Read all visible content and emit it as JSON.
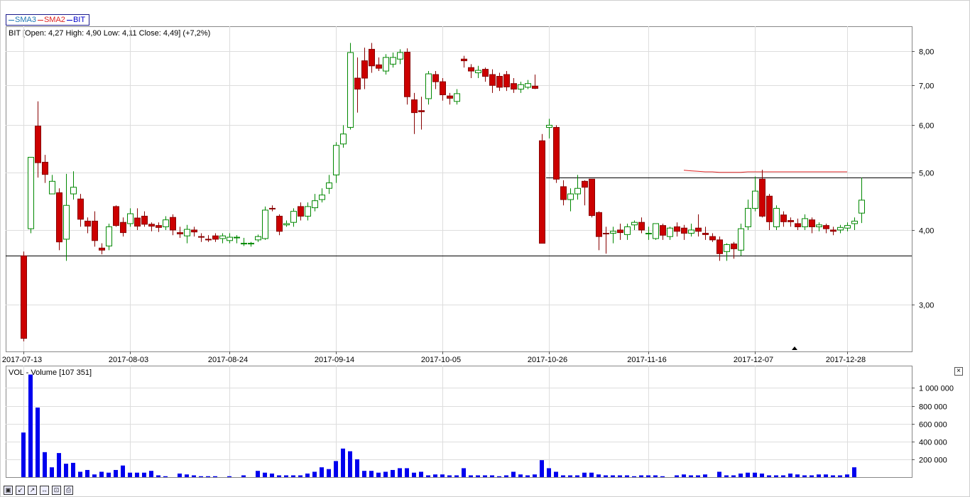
{
  "legend": [
    {
      "label": "SMA3",
      "color": "#1f77b4"
    },
    {
      "label": "SMA2",
      "color": "#dd2222"
    },
    {
      "label": "BIT",
      "color": "#0000cc"
    }
  ],
  "price_panel_title": "BIT [Open: 4,27  High: 4,90  Low: 4,11  Close: 4,49] (+7,2%)",
  "volume_panel_title": "VOL - Volume [107 351]",
  "toolbar": [
    {
      "name": "save-icon",
      "glyph": "▣"
    },
    {
      "name": "zoom-in-icon",
      "glyph": "↙"
    },
    {
      "name": "zoom-out-icon",
      "glyph": "↗"
    },
    {
      "name": "zoom-reset-icon",
      "glyph": "↔"
    },
    {
      "name": "fit-icon",
      "glyph": "⊡"
    },
    {
      "name": "print-icon",
      "glyph": "⎙"
    }
  ],
  "close_glyph": "×",
  "colors": {
    "up_body": "#ffffff",
    "up_outline": "#008800",
    "down_body": "#cc0000",
    "volume": "#0000ee",
    "grid": "#dddddd",
    "sma2": "#dd2222"
  },
  "chart_data": [
    {
      "type": "candlestick",
      "title": "BIT [Open: 4,27  High: 4,90  Low: 4,11  Close: 4,49] (+7,2%)",
      "scale": "log",
      "ylim": [
        2.5,
        8.8
      ],
      "y_ticks": [
        {
          "value": 3.0,
          "label": "3,00"
        },
        {
          "value": 4.0,
          "label": "4,00"
        },
        {
          "value": 5.0,
          "label": "5,00"
        },
        {
          "value": 6.0,
          "label": "6,00"
        },
        {
          "value": 7.0,
          "label": "7,00"
        },
        {
          "value": 8.0,
          "label": "8,00"
        }
      ],
      "x_ticks": [
        "2017-07-13",
        "2017-08-03",
        "2017-08-24",
        "2017-09-14",
        "2017-10-05",
        "2017-10-26",
        "2017-11-16",
        "2017-12-07",
        "2017-12-28"
      ],
      "horizontal_lines": [
        3.62,
        4.9
      ],
      "sma2": [
        5.04,
        5.03,
        5.02,
        5.01,
        5.01,
        5.0,
        5.0,
        5.0,
        5.0,
        5.01,
        5.01,
        5.01,
        5.01,
        5.01,
        5.01,
        5.01,
        5.01,
        5.01,
        5.01,
        5.01,
        5.01,
        5.01,
        5.01,
        5.01
      ],
      "candles": [
        [
          3.62,
          2.63,
          3.68,
          2.6
        ],
        [
          4.02,
          5.3,
          5.3,
          3.95
        ],
        [
          5.98,
          5.19,
          6.58,
          4.9
        ],
        [
          5.2,
          4.96,
          5.35,
          4.8
        ],
        [
          4.6,
          4.83,
          4.95,
          4.6
        ],
        [
          4.62,
          3.82,
          4.7,
          3.7
        ],
        [
          3.86,
          4.4,
          4.97,
          3.55
        ],
        [
          4.6,
          4.72,
          5.02,
          4.5
        ],
        [
          4.51,
          4.17,
          4.6,
          4.05
        ],
        [
          4.14,
          4.06,
          4.2,
          3.95
        ],
        [
          4.14,
          3.84,
          4.3,
          3.75
        ],
        [
          3.73,
          3.7,
          3.8,
          3.64
        ],
        [
          3.76,
          4.05,
          4.1,
          3.7
        ],
        [
          4.38,
          4.07,
          4.4,
          4.05
        ],
        [
          4.12,
          3.96,
          4.2,
          3.9
        ],
        [
          4.1,
          4.26,
          4.35,
          4.05
        ],
        [
          4.19,
          4.06,
          4.35,
          4.0
        ],
        [
          4.22,
          4.09,
          4.3,
          4.05
        ],
        [
          4.09,
          4.06,
          4.12,
          3.98
        ],
        [
          4.07,
          4.04,
          4.12,
          3.97
        ],
        [
          4.05,
          4.16,
          4.22,
          4.0
        ],
        [
          4.2,
          4.0,
          4.25,
          3.92
        ],
        [
          3.96,
          3.94,
          4.05,
          3.88
        ],
        [
          3.91,
          4.01,
          4.08,
          3.8
        ],
        [
          4.0,
          3.97,
          4.05,
          3.9
        ],
        [
          3.9,
          3.89,
          3.95,
          3.82
        ],
        [
          3.86,
          3.85,
          3.92,
          3.82
        ],
        [
          3.91,
          3.86,
          3.95,
          3.82
        ],
        [
          3.87,
          3.91,
          3.95,
          3.8
        ],
        [
          3.84,
          3.89,
          3.95,
          3.8
        ],
        [
          3.88,
          3.89,
          3.92,
          3.8
        ],
        [
          3.8,
          3.8,
          3.88,
          3.76
        ],
        [
          3.8,
          3.8,
          3.82,
          3.75
        ],
        [
          3.85,
          3.9,
          3.93,
          3.82
        ],
        [
          3.87,
          4.32,
          4.38,
          3.85
        ],
        [
          4.35,
          4.34,
          4.4,
          4.3
        ],
        [
          4.22,
          3.98,
          4.25,
          3.92
        ],
        [
          4.08,
          4.1,
          4.15,
          4.05
        ],
        [
          4.12,
          4.3,
          4.35,
          4.05
        ],
        [
          4.38,
          4.22,
          4.45,
          4.15
        ],
        [
          4.22,
          4.38,
          4.45,
          4.15
        ],
        [
          4.36,
          4.48,
          4.6,
          4.3
        ],
        [
          4.5,
          4.58,
          4.7,
          4.45
        ],
        [
          4.7,
          4.8,
          4.95,
          4.6
        ],
        [
          4.95,
          5.55,
          5.62,
          4.8
        ],
        [
          5.58,
          5.8,
          6.0,
          5.5
        ],
        [
          5.95,
          7.95,
          8.25,
          5.9
        ],
        [
          7.2,
          6.9,
          7.8,
          6.3
        ],
        [
          7.7,
          7.2,
          8.1,
          6.9
        ],
        [
          8.05,
          7.55,
          8.25,
          7.35
        ],
        [
          7.58,
          7.48,
          7.8,
          7.4
        ],
        [
          7.4,
          7.8,
          7.9,
          7.3
        ],
        [
          7.6,
          7.8,
          7.95,
          7.5
        ],
        [
          7.75,
          7.95,
          8.05,
          7.6
        ],
        [
          7.96,
          6.7,
          8.08,
          6.5
        ],
        [
          6.62,
          6.3,
          6.8,
          5.8
        ],
        [
          6.35,
          6.32,
          6.7,
          5.9
        ],
        [
          6.65,
          7.32,
          7.4,
          6.5
        ],
        [
          7.3,
          7.1,
          7.4,
          6.9
        ],
        [
          7.1,
          6.75,
          7.2,
          6.6
        ],
        [
          6.72,
          6.66,
          6.8,
          6.5
        ],
        [
          6.58,
          6.78,
          6.9,
          6.5
        ],
        [
          7.75,
          7.7,
          7.85,
          7.5
        ],
        [
          7.5,
          7.4,
          7.6,
          7.2
        ],
        [
          7.35,
          7.42,
          7.55,
          7.2
        ],
        [
          7.45,
          7.25,
          7.5,
          7.1
        ],
        [
          7.3,
          7.0,
          7.45,
          6.8
        ],
        [
          7.25,
          6.95,
          7.35,
          6.85
        ],
        [
          7.3,
          6.96,
          7.4,
          6.85
        ],
        [
          7.05,
          6.9,
          7.2,
          6.8
        ],
        [
          6.9,
          7.02,
          7.1,
          6.8
        ],
        [
          6.95,
          7.05,
          7.15,
          6.9
        ],
        [
          6.98,
          6.92,
          7.3,
          6.9
        ],
        [
          5.65,
          3.8,
          5.8,
          3.8
        ],
        [
          5.95,
          6.0,
          6.15,
          5.7
        ],
        [
          5.95,
          4.87,
          6.0,
          4.8
        ],
        [
          4.73,
          4.5,
          4.85,
          4.4
        ],
        [
          4.5,
          4.6,
          4.7,
          4.3
        ],
        [
          4.6,
          4.7,
          4.95,
          4.5
        ],
        [
          4.83,
          4.72,
          4.85,
          4.4
        ],
        [
          4.87,
          4.23,
          4.87,
          4.2
        ],
        [
          4.28,
          3.9,
          4.3,
          3.7
        ],
        [
          3.95,
          3.94,
          4.05,
          3.65
        ],
        [
          3.95,
          3.98,
          4.05,
          3.8
        ],
        [
          4.0,
          3.96,
          4.1,
          3.85
        ],
        [
          3.93,
          4.05,
          4.1,
          3.85
        ],
        [
          4.08,
          4.12,
          4.15,
          4.0
        ],
        [
          4.12,
          4.0,
          4.2,
          3.95
        ],
        [
          3.94,
          3.95,
          4.05,
          3.85
        ],
        [
          3.87,
          4.1,
          4.1,
          3.85
        ],
        [
          4.07,
          3.92,
          4.1,
          3.85
        ],
        [
          3.9,
          4.03,
          4.05,
          3.85
        ],
        [
          4.05,
          3.98,
          4.12,
          3.9
        ],
        [
          4.03,
          3.95,
          4.08,
          3.85
        ],
        [
          3.95,
          4.0,
          4.1,
          3.9
        ],
        [
          4.03,
          3.98,
          4.25,
          3.9
        ],
        [
          3.95,
          3.93,
          4.05,
          3.85
        ],
        [
          3.9,
          3.85,
          3.95,
          3.82
        ],
        [
          3.85,
          3.65,
          3.9,
          3.55
        ],
        [
          3.68,
          3.78,
          3.8,
          3.55
        ],
        [
          3.79,
          3.72,
          3.82,
          3.58
        ],
        [
          3.7,
          4.02,
          4.1,
          3.62
        ],
        [
          4.05,
          4.35,
          4.5,
          4.0
        ],
        [
          4.35,
          4.65,
          4.92,
          4.3
        ],
        [
          4.87,
          4.22,
          5.05,
          4.2
        ],
        [
          4.56,
          4.13,
          4.6,
          4.0
        ],
        [
          4.05,
          4.35,
          4.4,
          4.0
        ],
        [
          4.24,
          4.13,
          4.3,
          4.05
        ],
        [
          4.15,
          4.13,
          4.2,
          4.05
        ],
        [
          4.1,
          4.05,
          4.18,
          4.0
        ],
        [
          4.05,
          4.18,
          4.25,
          4.0
        ],
        [
          4.16,
          4.05,
          4.2,
          3.95
        ],
        [
          4.05,
          4.08,
          4.12,
          3.98
        ],
        [
          4.07,
          4.02,
          4.1,
          3.95
        ],
        [
          4.0,
          3.98,
          4.05,
          3.92
        ],
        [
          4.0,
          4.04,
          4.08,
          3.95
        ],
        [
          4.03,
          4.07,
          4.12,
          3.98
        ],
        [
          4.1,
          4.14,
          4.2,
          4.0
        ],
        [
          4.27,
          4.49,
          4.9,
          4.11
        ]
      ]
    },
    {
      "type": "bar",
      "title": "VOL - Volume [107 351]",
      "ylim": [
        0,
        1250000
      ],
      "y_ticks": [
        {
          "value": 200000,
          "label": "200 000"
        },
        {
          "value": 400000,
          "label": "400 000"
        },
        {
          "value": 600000,
          "label": "600 000"
        },
        {
          "value": 800000,
          "label": "800 000"
        },
        {
          "value": 1000000,
          "label": "1 000 000"
        }
      ],
      "values": [
        500000,
        1150000,
        780000,
        280000,
        110000,
        270000,
        150000,
        160000,
        60000,
        80000,
        30000,
        60000,
        50000,
        80000,
        130000,
        50000,
        50000,
        50000,
        70000,
        20000,
        10000,
        0,
        40000,
        30000,
        20000,
        10000,
        10000,
        10000,
        0,
        10000,
        0,
        20000,
        0,
        70000,
        50000,
        40000,
        20000,
        20000,
        20000,
        20000,
        40000,
        60000,
        110000,
        90000,
        180000,
        320000,
        290000,
        200000,
        70000,
        70000,
        50000,
        60000,
        80000,
        100000,
        100000,
        50000,
        60000,
        20000,
        30000,
        30000,
        20000,
        20000,
        100000,
        20000,
        20000,
        20000,
        20000,
        10000,
        20000,
        60000,
        30000,
        20000,
        30000,
        190000,
        100000,
        60000,
        20000,
        20000,
        20000,
        50000,
        50000,
        30000,
        20000,
        20000,
        20000,
        20000,
        10000,
        20000,
        20000,
        20000,
        10000,
        0,
        20000,
        30000,
        20000,
        20000,
        30000,
        0,
        60000,
        20000,
        20000,
        40000,
        50000,
        50000,
        40000,
        20000,
        20000,
        20000,
        40000,
        30000,
        20000,
        20000,
        30000,
        30000,
        20000,
        20000,
        30000,
        110000
      ]
    }
  ]
}
